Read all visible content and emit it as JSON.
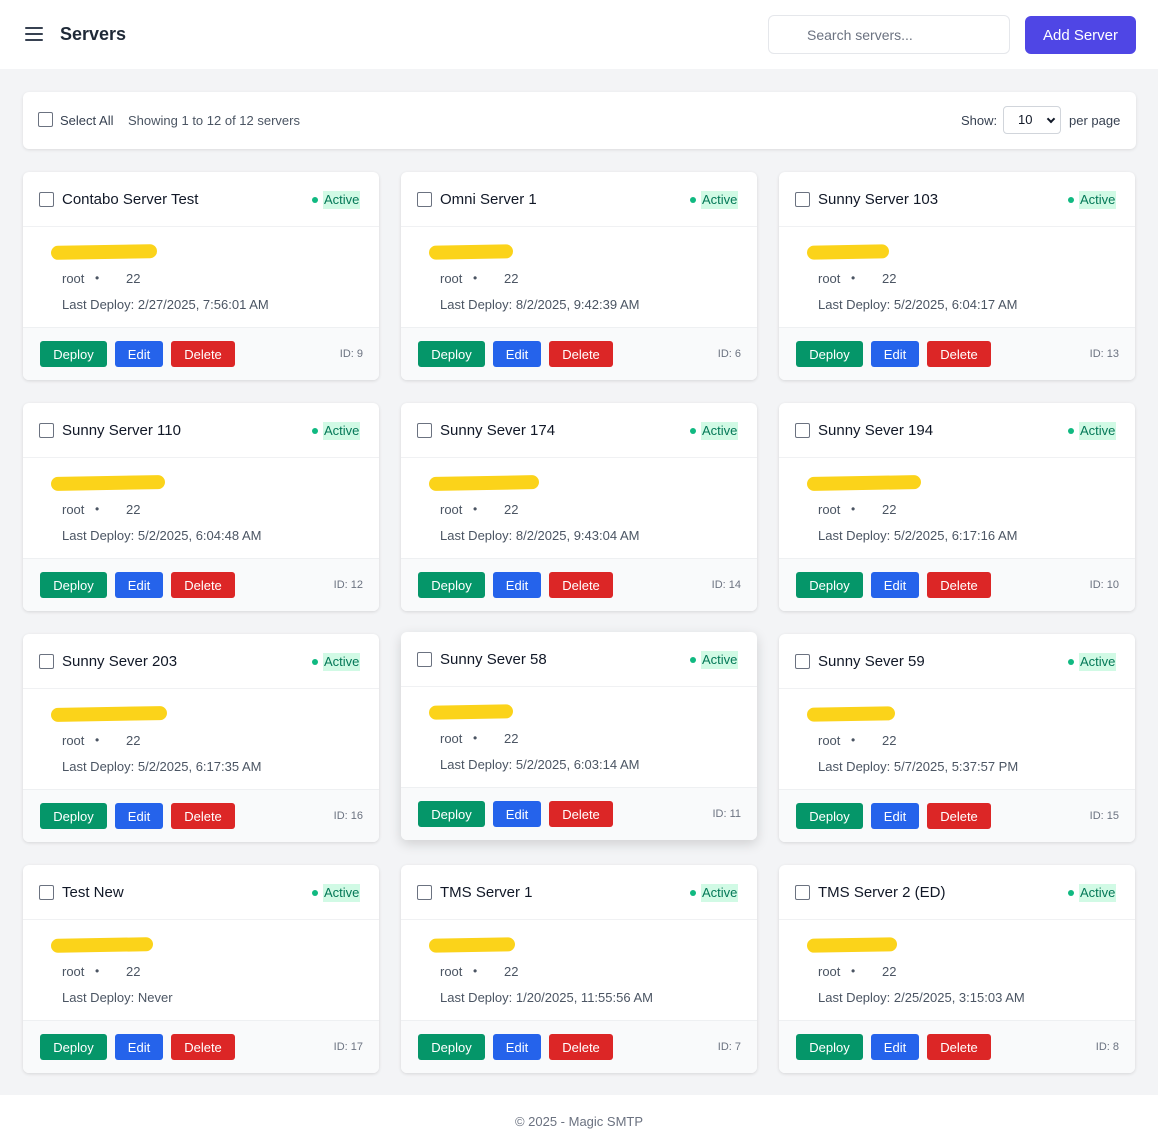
{
  "header": {
    "title": "Servers",
    "search_placeholder": "Search servers...",
    "add_button": "Add Server"
  },
  "toolbar": {
    "select_all": "Select All",
    "showing": "Showing 1 to 12 of 12 servers",
    "show_label": "Show:",
    "per_page_value": "10",
    "per_page_label": "per page"
  },
  "card_labels": {
    "deploy": "Deploy",
    "edit": "Edit",
    "delete": "Delete",
    "status": "Active",
    "user": "root",
    "separator": "•",
    "port": "22"
  },
  "servers": [
    {
      "name": "Contabo Server Test",
      "last_deploy": "Last Deploy: 2/27/2025, 7:56:01 AM",
      "id": "ID: 9"
    },
    {
      "name": "Omni Server 1",
      "last_deploy": "Last Deploy: 8/2/2025, 9:42:39 AM",
      "id": "ID: 6"
    },
    {
      "name": "Sunny Server 103",
      "last_deploy": "Last Deploy: 5/2/2025, 6:04:17 AM",
      "id": "ID: 13"
    },
    {
      "name": "Sunny Server 110",
      "last_deploy": "Last Deploy: 5/2/2025, 6:04:48 AM",
      "id": "ID: 12"
    },
    {
      "name": "Sunny Sever 174",
      "last_deploy": "Last Deploy: 8/2/2025, 9:43:04 AM",
      "id": "ID: 14"
    },
    {
      "name": "Sunny Sever 194",
      "last_deploy": "Last Deploy: 5/2/2025, 6:17:16 AM",
      "id": "ID: 10"
    },
    {
      "name": "Sunny Sever 203",
      "last_deploy": "Last Deploy: 5/2/2025, 6:17:35 AM",
      "id": "ID: 16"
    },
    {
      "name": "Sunny Sever 58",
      "last_deploy": "Last Deploy: 5/2/2025, 6:03:14 AM",
      "id": "ID: 11"
    },
    {
      "name": "Sunny Sever 59",
      "last_deploy": "Last Deploy: 5/7/2025, 5:37:57 PM",
      "id": "ID: 15"
    },
    {
      "name": "Test New",
      "last_deploy": "Last Deploy: Never",
      "id": "ID: 17"
    },
    {
      "name": "TMS Server 1",
      "last_deploy": "Last Deploy: 1/20/2025, 11:55:56 AM",
      "id": "ID: 7"
    },
    {
      "name": "TMS Server 2 (ED)",
      "last_deploy": "Last Deploy: 2/25/2025, 3:15:03 AM",
      "id": "ID: 8"
    }
  ],
  "colors": {
    "primary": "#4f46e5",
    "deploy": "#059669",
    "edit": "#2563eb",
    "delete": "#dc2626",
    "active": "#10b981",
    "redaction": "#fbd31a"
  },
  "footer": {
    "text": "© 2025 - Magic SMTP"
  }
}
